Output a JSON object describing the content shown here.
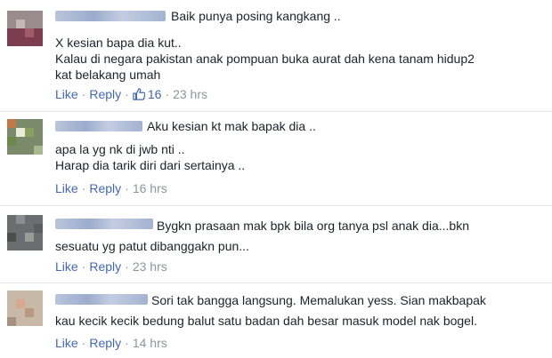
{
  "comments": [
    {
      "first_line": "Baik punya posing kangkang ..",
      "body": "X kesian bapa dia kut..\nKalau di negara pakistan anak pompuan buka aurat dah kena tanam hidup2\nkat belakang umah",
      "actions": {
        "like": "Like",
        "reply": "Reply",
        "like_count": "16",
        "time": "23 hrs"
      }
    },
    {
      "first_line": "Aku kesian kt mak bapak dia ..",
      "body": "apa la yg nk di jwb nti ..\nHarap dia tarik diri dari sertainya ..",
      "actions": {
        "like": "Like",
        "reply": "Reply",
        "time": "16 hrs"
      }
    },
    {
      "first_line": "Bygkn prasaan mak bpk bila org tanya psl anak dia...bkn",
      "body": "sesuatu yg patut dibanggakn pun...",
      "actions": {
        "like": "Like",
        "reply": "Reply",
        "time": "23 hrs"
      }
    },
    {
      "first_line": "Sori tak bangga langsung. Memalukan yess. Sian makbapak",
      "body": "kau kecik kecik bedung balut satu badan dah besar masuk model nak bogel.",
      "actions": {
        "like": "Like",
        "reply": "Reply",
        "time": "14 hrs"
      }
    }
  ],
  "separator": "·",
  "colors": {
    "link": "#4267b2",
    "meta": "#90949c",
    "text": "#1d2129"
  },
  "icons": {
    "like_count_icon": "thumbs-up-icon"
  }
}
